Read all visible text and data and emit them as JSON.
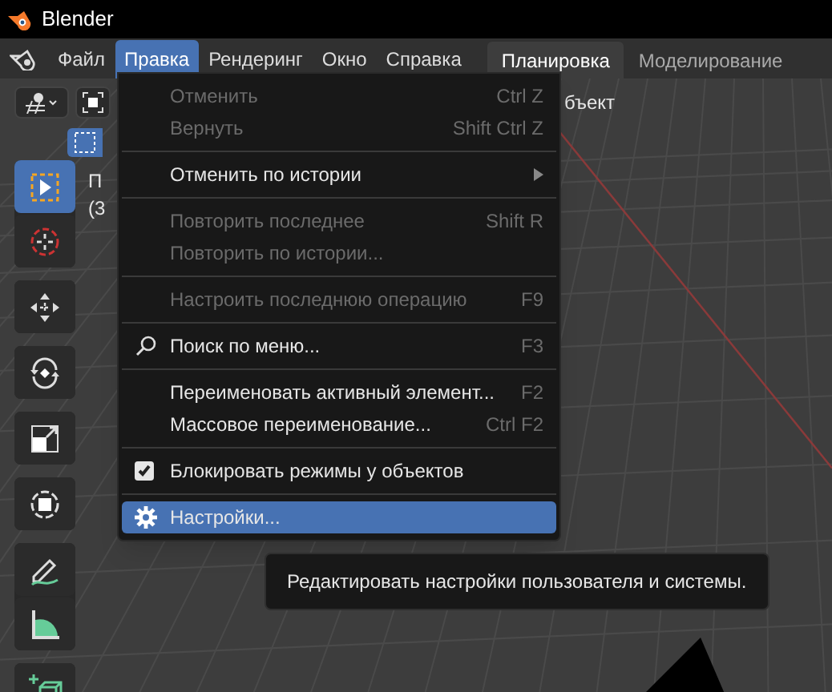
{
  "window": {
    "title": "Blender"
  },
  "menubar": [
    {
      "label": "Файл",
      "selected": false
    },
    {
      "label": "Правка",
      "selected": true
    },
    {
      "label": "Рендеринг",
      "selected": false
    },
    {
      "label": "Окно",
      "selected": false
    },
    {
      "label": "Справка",
      "selected": false
    }
  ],
  "workspaces": [
    {
      "label": "Планировка",
      "selected": true
    },
    {
      "label": "Моделирование",
      "selected": false
    }
  ],
  "viewport": {
    "header_text": "бъект",
    "overlay_lines": [
      "П",
      "(3"
    ]
  },
  "toolbar": [
    {
      "kind": "select",
      "selected": true
    },
    {
      "kind": "cursor",
      "selected": false
    },
    {
      "kind": "move",
      "selected": false
    },
    {
      "kind": "rotate",
      "selected": false
    },
    {
      "kind": "scale",
      "selected": false
    },
    {
      "kind": "transform",
      "selected": false
    },
    {
      "kind": "annotate",
      "selected": false
    },
    {
      "kind": "measure",
      "selected": false
    },
    {
      "kind": "add",
      "selected": false
    }
  ],
  "menu": [
    {
      "kind": "item",
      "label": "Отменить",
      "shortcut": "Ctrl Z",
      "disabled": true,
      "selected": false
    },
    {
      "kind": "item",
      "label": "Вернуть",
      "shortcut": "Shift Ctrl Z",
      "disabled": true,
      "selected": false
    },
    {
      "kind": "separator"
    },
    {
      "kind": "submenu",
      "label": "Отменить по истории",
      "disabled": false,
      "selected": false
    },
    {
      "kind": "separator"
    },
    {
      "kind": "item",
      "label": "Повторить последнее",
      "shortcut": "Shift R",
      "disabled": true,
      "selected": false
    },
    {
      "kind": "item",
      "label": "Повторить по истории...",
      "disabled": true,
      "selected": false
    },
    {
      "kind": "separator"
    },
    {
      "kind": "item",
      "label": "Настроить последнюю операцию",
      "shortcut": "F9",
      "disabled": true,
      "selected": false
    },
    {
      "kind": "separator"
    },
    {
      "kind": "search",
      "label": "Поиск по меню...",
      "shortcut": "F3",
      "disabled": false,
      "selected": false
    },
    {
      "kind": "separator"
    },
    {
      "kind": "item",
      "label": "Переименовать активный элемент...",
      "shortcut": "F2",
      "disabled": false,
      "selected": false
    },
    {
      "kind": "item",
      "label": "Массовое переименование...",
      "shortcut": "Ctrl F2",
      "disabled": false,
      "selected": false
    },
    {
      "kind": "separator"
    },
    {
      "kind": "checkbox",
      "label": "Блокировать режимы у объектов",
      "checked": true,
      "disabled": false,
      "selected": false
    },
    {
      "kind": "separator"
    },
    {
      "kind": "settings",
      "label": "Настройки...",
      "disabled": false,
      "selected": true
    }
  ],
  "tooltip": "Редактировать настройки пользователя и системы."
}
